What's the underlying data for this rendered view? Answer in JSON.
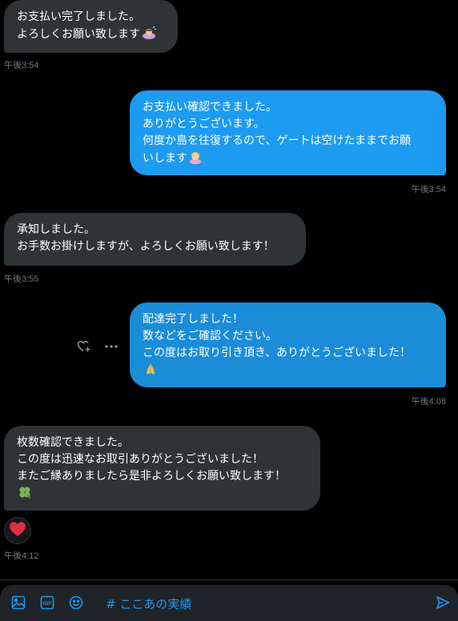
{
  "messages": [
    {
      "side": "in",
      "lines": [
        "お支払い完了しました。",
        "よろしくお願い致します"
      ],
      "time": "午後3:54"
    },
    {
      "side": "out",
      "lines": [
        "お支払い確認できました。",
        "ありがとうございます。",
        "何度か島を往復するので、ゲートは空けたままでお願",
        "いします"
      ],
      "time": "午後3:54"
    },
    {
      "side": "in",
      "lines": [
        "承知しました。",
        "お手数お掛けしますが、よろしくお願い致します！"
      ],
      "time": "午後3:55"
    },
    {
      "side": "out",
      "lines": [
        "配達完了しました！",
        "数などをご確認ください。",
        "この度はお取り引き頂き、ありがとうございました！",
        ""
      ],
      "time": "午後4:08"
    },
    {
      "side": "in",
      "lines": [
        "枚数確認できました。",
        "この度は迅速なお取引ありがとうございました！",
        "またご縁ありましたら是非よろしくお願い致します！",
        ""
      ],
      "time": "午後4:12"
    }
  ],
  "composer": {
    "value": "# ここあの実績",
    "icons": [
      "image-icon",
      "gif-icon",
      "emoji-icon",
      "send-icon"
    ]
  },
  "reaction": {
    "emoji": "heart"
  },
  "colors": {
    "bubble_in": "#2f3336",
    "bubble_out": "#1d9bf0",
    "accent": "#1d9bf0",
    "background": "#000000"
  }
}
